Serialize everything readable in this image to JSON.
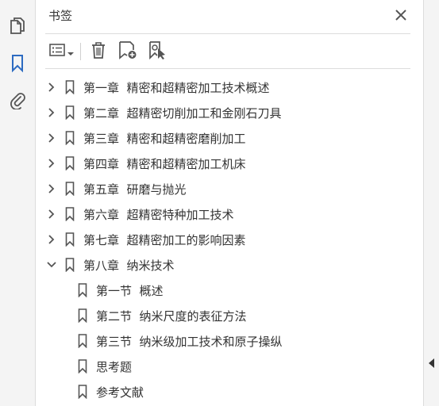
{
  "panel": {
    "title": "书签"
  },
  "icons": {
    "rail": [
      "pages-icon",
      "bookmark-icon",
      "attachment-icon"
    ],
    "toolbar": [
      "options-icon",
      "delete-icon",
      "new-bookmark-icon",
      "bookmark-from-selection-icon"
    ],
    "close": "close-icon"
  },
  "colors": {
    "active": "#2d6bc1",
    "icon": "#555555",
    "text": "#333333"
  },
  "bookmarks": [
    {
      "label": "第一章  精密和超精密加工技术概述",
      "level": 0,
      "expanded": false
    },
    {
      "label": "第二章  超精密切削加工和金刚石刀具",
      "level": 0,
      "expanded": false
    },
    {
      "label": "第三章  精密和超精密磨削加工",
      "level": 0,
      "expanded": false
    },
    {
      "label": "第四章  精密和超精密加工机床",
      "level": 0,
      "expanded": false
    },
    {
      "label": "第五章  研磨与抛光",
      "level": 0,
      "expanded": false
    },
    {
      "label": "第六章  超精密特种加工技术",
      "level": 0,
      "expanded": false
    },
    {
      "label": "第七章  超精密加工的影响因素",
      "level": 0,
      "expanded": false
    },
    {
      "label": "第八章  纳米技术",
      "level": 0,
      "expanded": true
    },
    {
      "label": "第一节  概述",
      "level": 1
    },
    {
      "label": "第二节  纳米尺度的表征方法",
      "level": 1
    },
    {
      "label": "第三节  纳米级加工技术和原子操纵",
      "level": 1
    },
    {
      "label": "思考题",
      "level": 1
    },
    {
      "label": "参考文献",
      "level": 1
    }
  ]
}
